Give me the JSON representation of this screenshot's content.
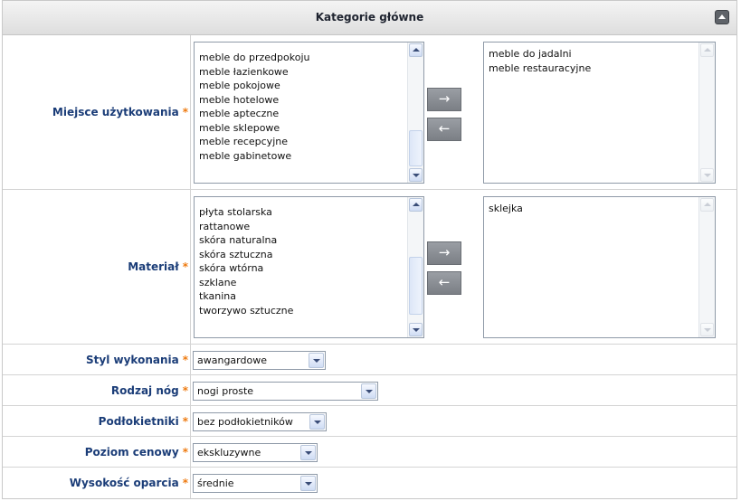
{
  "header": {
    "title": "Kategorie główne"
  },
  "required_mark": "*",
  "arrows": {
    "add": "→",
    "remove": "←"
  },
  "miejsce": {
    "label": "Miejsce użytkowania",
    "available": [
      "meble do przedpokoju",
      "meble łazienkowe",
      "meble pokojowe",
      "meble hotelowe",
      "meble apteczne",
      "meble sklepowe",
      "meble recepcyjne",
      "meble gabinetowe"
    ],
    "selected": [
      "meble do jadalni",
      "meble restauracyjne"
    ]
  },
  "material": {
    "label": "Materiał",
    "available": [
      "płyta stolarska",
      "rattanowe",
      "skóra naturalna",
      "skóra sztuczna",
      "skóra wtórna",
      "szklane",
      "tkanina",
      "tworzywo sztuczne"
    ],
    "selected": [
      "sklejka"
    ]
  },
  "styl": {
    "label": "Styl wykonania",
    "value": "awangardowe"
  },
  "rodzaj": {
    "label": "Rodzaj nóg",
    "value": "nogi proste"
  },
  "podlokietniki": {
    "label": "Podłokietniki",
    "value": "bez podłokietników"
  },
  "poziom": {
    "label": "Poziom cenowy",
    "value": "ekskluzywne"
  },
  "wysokosc": {
    "label": "Wysokość oparcia",
    "value": "średnie"
  }
}
